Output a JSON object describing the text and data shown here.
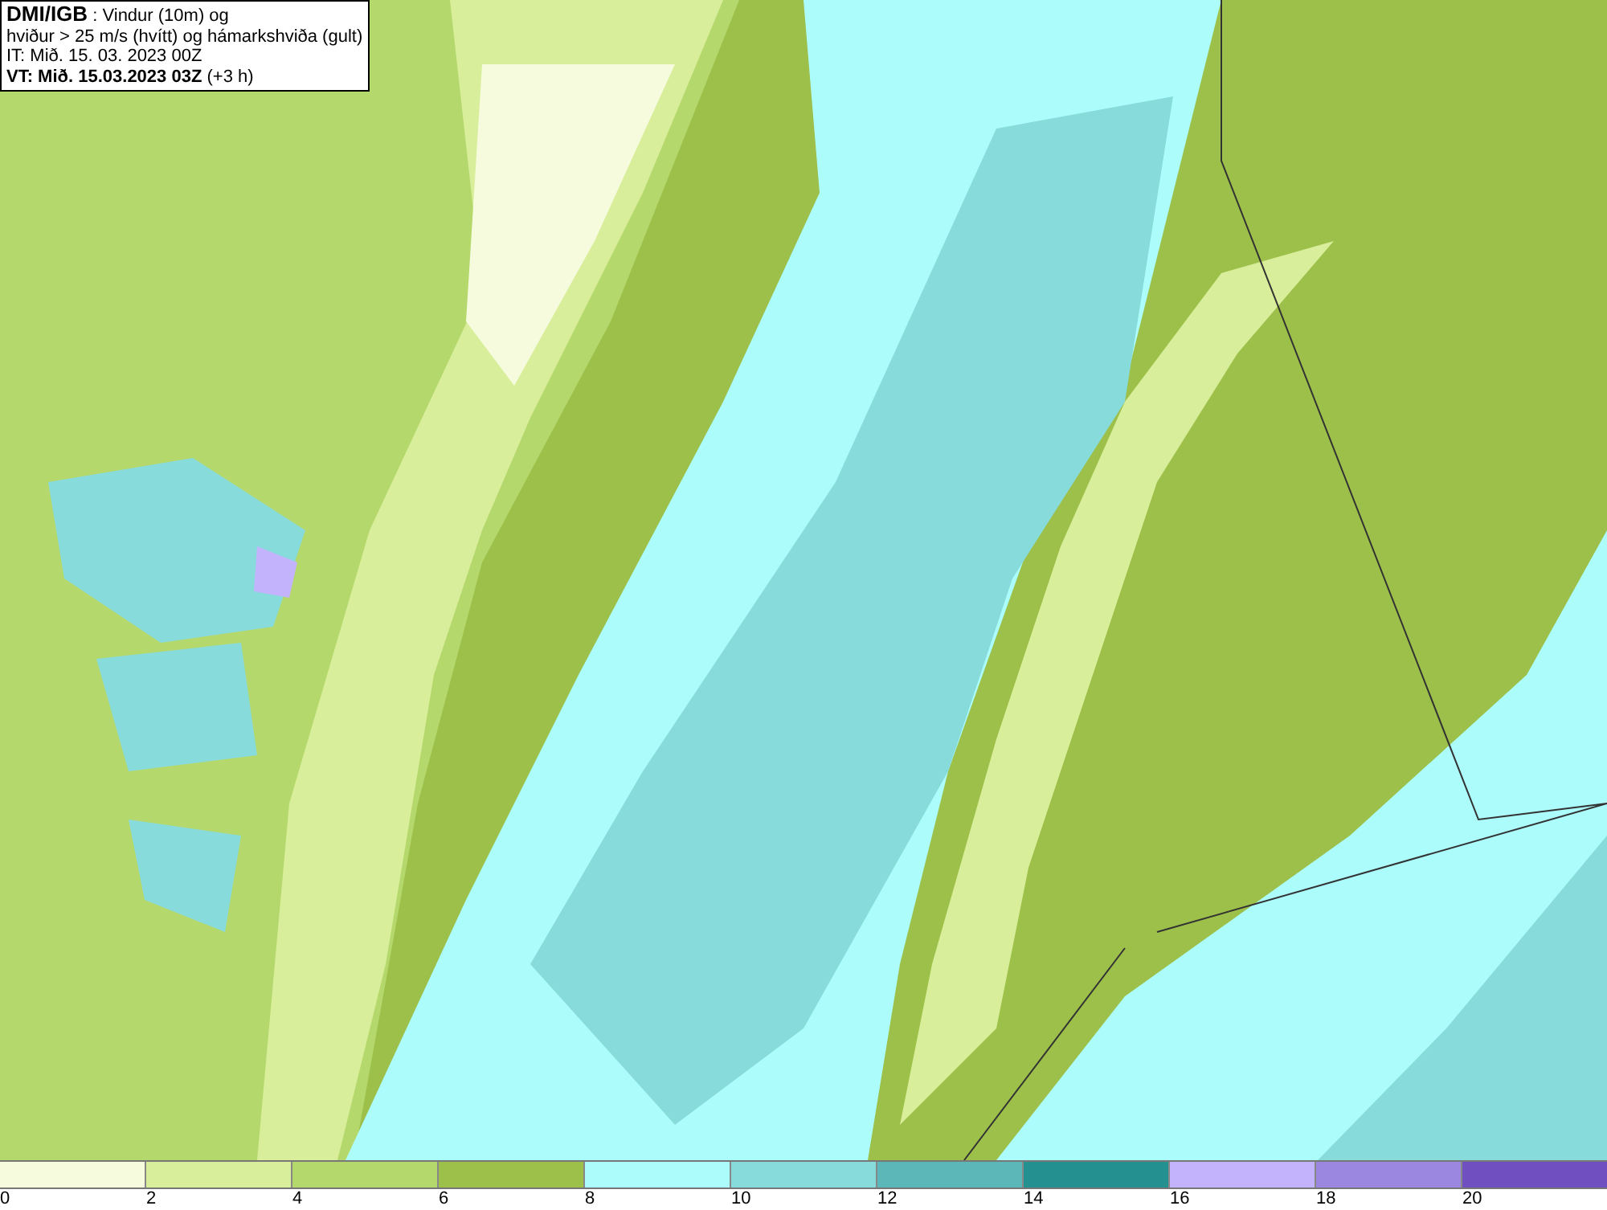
{
  "header": {
    "source": "DMI/IGB",
    "title": " : Vindur (10m) og",
    "subtitle": "hviður > 25 m/s (hvítt) og hámarkshviða (gult)",
    "initial_time": "IT: Mið. 15. 03. 2023 00Z",
    "valid_time": "VT: Mið. 15.03.2023 03Z",
    "offset": " (+3 h)"
  },
  "legend": {
    "bins": [
      {
        "color": "#f5fbdc"
      },
      {
        "color": "#d8ee9a"
      },
      {
        "color": "#b5d86d"
      },
      {
        "color": "#9dc04a"
      },
      {
        "color": "#adfcfc"
      },
      {
        "color": "#88dbdb"
      },
      {
        "color": "#5cb8b8"
      },
      {
        "color": "#249090"
      },
      {
        "color": "#c3b3fc"
      },
      {
        "color": "#9b86e0"
      },
      {
        "color": "#7050c0"
      }
    ],
    "ticks": [
      "0",
      "2",
      "4",
      "6",
      "8",
      "10",
      "12",
      "14",
      "16",
      "18",
      "20"
    ]
  }
}
